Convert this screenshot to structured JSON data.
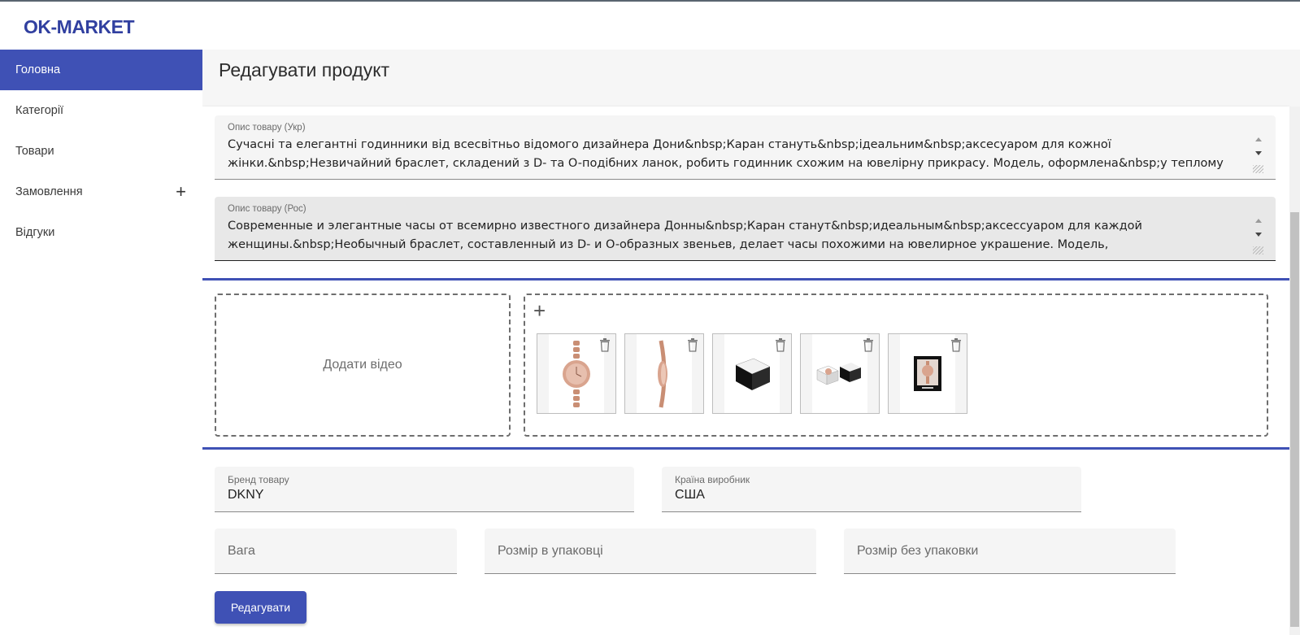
{
  "app": {
    "logo": "OK-MARKET"
  },
  "sidebar": {
    "items": [
      {
        "label": "Головна",
        "active": true
      },
      {
        "label": "Категорії"
      },
      {
        "label": "Товари"
      },
      {
        "label": "Замовлення",
        "expand": "+"
      },
      {
        "label": "Відгуки"
      }
    ]
  },
  "page": {
    "title": "Редагувати продукт"
  },
  "form": {
    "desc_ua": {
      "label": "Опис товару (Укр)",
      "value": "Сучасні та елегантні годинники від всесвітньо відомого дизайнера Дони&nbsp;Каран стануть&nbsp;ідеальним&nbsp;аксесуаром для кожної жінки.&nbsp;Незвичайний браслет, складений з D- та O-подібних ланок, робить годинник схожим на ювелірну прикрасу. Модель, оформлена&nbsp;у теплому"
    },
    "desc_ru": {
      "label": "Опис товару (Рос)",
      "value": "Современные и элегантные часы от всемирно известного дизайнера Донны&nbsp;Каран станут&nbsp;идеальным&nbsp;аксессуаром для каждой женщины.&nbsp;Необычный браслет, составленный из D- и O-образных звеньев, делает часы похожими на ювелирное украшение. Модель,"
    },
    "video": {
      "label": "Додати відео"
    },
    "images": {
      "add_icon": "+",
      "count": 5
    },
    "brand": {
      "label": "Бренд товару",
      "value": "DKNY"
    },
    "country": {
      "label": "Країна виробник",
      "value": "США"
    },
    "weight": {
      "placeholder": "Вага"
    },
    "size_packed": {
      "placeholder": "Розмір в упаковці"
    },
    "size_unpacked": {
      "placeholder": "Розмір без упаковки"
    },
    "submit_label": "Редагувати"
  },
  "colors": {
    "accent": "#3f51b5",
    "logo": "#3140a0"
  }
}
